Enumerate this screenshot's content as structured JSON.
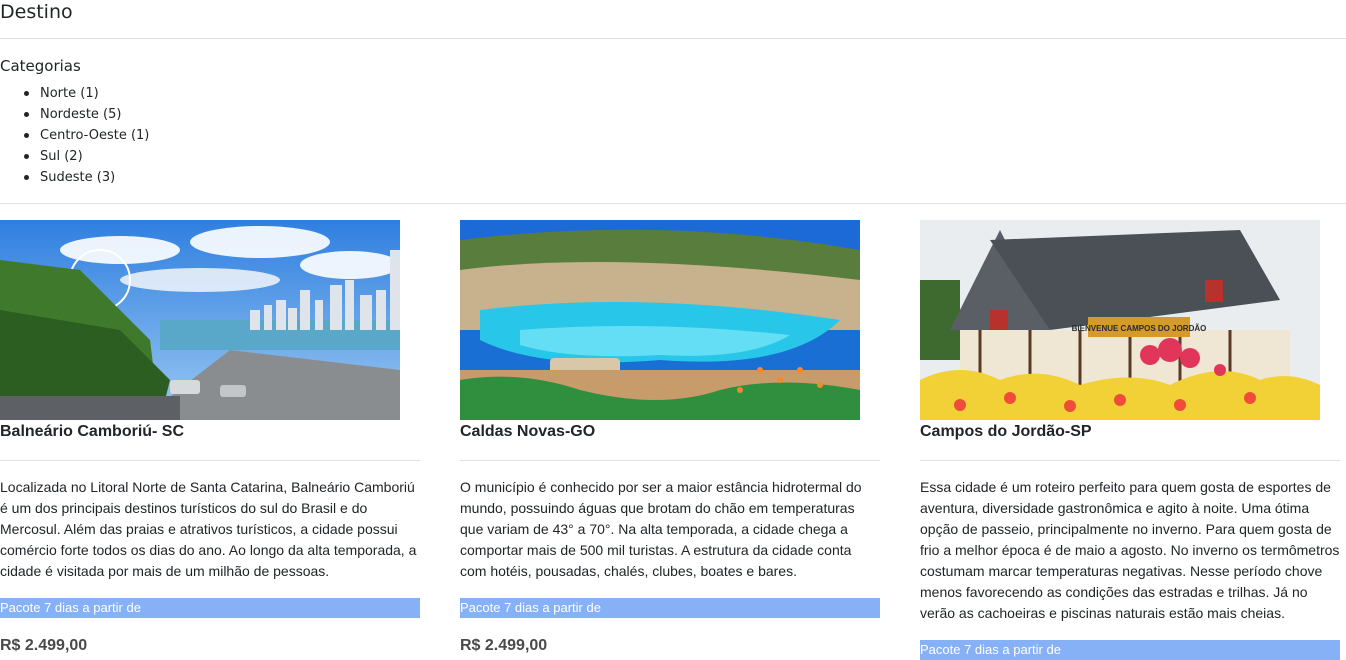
{
  "page": {
    "title": "Destino"
  },
  "categories": {
    "title": "Categorias",
    "items": [
      {
        "label": "Norte (1)"
      },
      {
        "label": "Nordeste (5)"
      },
      {
        "label": "Centro-Oeste (1)"
      },
      {
        "label": "Sul (2)"
      },
      {
        "label": "Sudeste (3)"
      }
    ]
  },
  "destinations": [
    {
      "name": "Balneário Camboriú- SC",
      "description": "Localizada no Litoral Norte de Santa Catarina, Balneário Camboriú é um dos principais destinos turísticos do sul do Brasil e do Mercosul. Além das praias e atrativos turísticos, a cidade possui comércio forte todos os dias do ano. Ao longo da alta temporada, a cidade é visitada por mais de um milhão de pessoas.",
      "package_label": "Pacote 7 dias a partir de",
      "price": "R$ 2.499,00"
    },
    {
      "name": "Caldas Novas-GO",
      "description": "O município é conhecido por ser a maior estância hidrotermal do mundo, possuindo águas que brotam do chão em temperaturas que variam de 43° a 70°. Na alta temporada, a cidade chega a comportar mais de 500 mil turistas. A estrutura da cidade conta com hotéis, pousadas, chalés, clubes, boates e bares.",
      "package_label": "Pacote 7 dias a partir de",
      "price": "R$ 2.499,00"
    },
    {
      "name": "Campos do Jordão-SP",
      "description": "Essa cidade é um roteiro perfeito para quem gosta de esportes de aventura, diversidade gastronômica e agito à noite. Uma ótima opção de passeio, principalmente no inverno. Para quem gosta de frio a melhor época é de maio a agosto. No inverno os termômetros costumam marcar temperaturas negativas. Nesse período chove menos favorecendo as condições das estradas e trilhas. Já no verão as cachoeiras e piscinas naturais estão mais cheias.",
      "package_label": "Pacote 7 dias a partir de",
      "sign_text": "BIENVENUE CAMPOS DO JORDÃO"
    }
  ]
}
